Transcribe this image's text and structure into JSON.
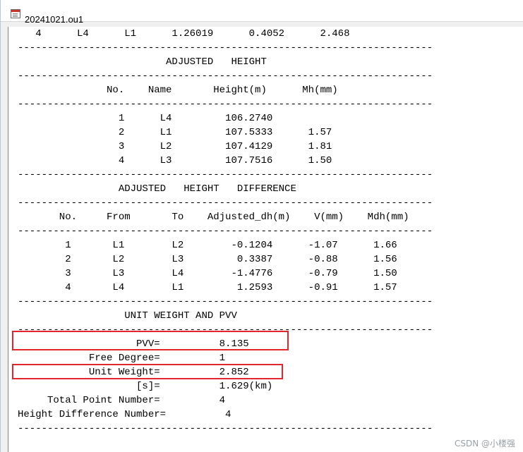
{
  "window": {
    "title": "20241021.ou1",
    "icon": "document-icon"
  },
  "report": {
    "top_row": "   4      L4      L1      1.26019      0.4052      2.468",
    "sep1": "----------------------------------------------------------------------",
    "adjusted_height_title": "                         ADJUSTED   HEIGHT",
    "sep2": "----------------------------------------------------------------------",
    "height_header": "               No.    Name       Height(m)      Mh(mm)",
    "sep3": "----------------------------------------------------------------------",
    "height_rows": [
      "                 1      L4         106.2740",
      "                 2      L1         107.5333      1.57",
      "                 3      L2         107.4129      1.81",
      "                 4      L3         107.7516      1.50"
    ],
    "sep4": "----------------------------------------------------------------------",
    "adjusted_dh_title": "                 ADJUSTED   HEIGHT   DIFFERENCE",
    "sep5": "----------------------------------------------------------------------",
    "dh_header": "       No.     From       To    Adjusted_dh(m)    V(mm)    Mdh(mm)",
    "sep6": "----------------------------------------------------------------------",
    "dh_rows": [
      "        1       L1        L2        -0.1204      -1.07      1.66",
      "        2       L2        L3         0.3387      -0.88      1.56",
      "        3       L3        L4        -1.4776      -0.79      1.50",
      "        4       L4        L1         1.2593      -0.91      1.57"
    ],
    "sep7": "----------------------------------------------------------------------",
    "unit_weight_title": "                  UNIT WEIGHT AND PVV",
    "sep8": "----------------------------------------------------------------------",
    "pvv": "                    PVV=          8.135",
    "free_degree": "            Free Degree=          1",
    "unit_weight": "            Unit Weight=          2.852",
    "s": "                    [s]=          1.629(km)",
    "total_point": "     Total Point Number=          4",
    "hd_number": "Height Difference Number=          4",
    "sep9": "----------------------------------------------------------------------"
  },
  "watermark": "CSDN @小楼强",
  "colors": {
    "highlight": "#e3262b"
  }
}
